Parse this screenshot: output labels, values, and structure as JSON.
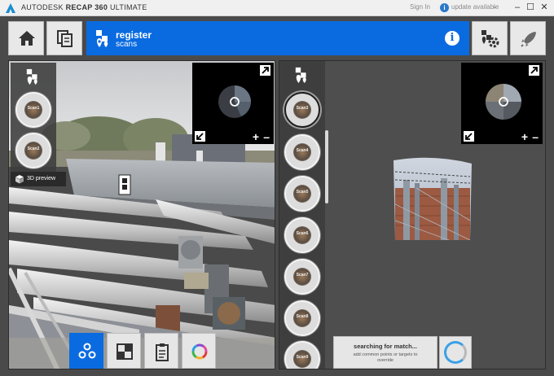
{
  "titlebar": {
    "title_brand": "AUTODESK",
    "title_product": "RECAP 360",
    "title_edition": "ULTIMATE",
    "signin": "Sign In",
    "update": "update available",
    "update_icon": "i",
    "update_caret": "⌄",
    "minimize": "–",
    "maximize": "☐",
    "close": "✕"
  },
  "banner": {
    "title": "register",
    "subtitle": "scans",
    "info_icon": "i"
  },
  "left_panel": {
    "thumbnails": [
      "Scan1",
      "Scan2"
    ],
    "preview_label": "3D preview",
    "minimap_plus": "+",
    "minimap_minus": "–"
  },
  "right_panel": {
    "thumbnails": [
      "Scan3",
      "Scan4",
      "Scan5",
      "Scan6",
      "Scan7",
      "Scan8",
      "Scan9"
    ],
    "minimap_plus": "+",
    "minimap_minus": "–",
    "search_title": "searching for match...",
    "search_subtitle": "add common points or targets to override"
  },
  "colors": {
    "accent": "#0a6be0",
    "panel_bg": "#4a4a4a",
    "spinner": "#3aa0e6"
  },
  "icons": {
    "home": "home-icon",
    "scans": "copy-icon",
    "register": "register-icon",
    "info": "info-icon",
    "settings": "settings-icon",
    "launch": "rocket-icon",
    "preview_3d": "cube-icon",
    "clusters": "clusters-icon",
    "split_view": "split-view-icon",
    "report": "clipboard-icon",
    "color_mode": "color-wheel-icon"
  }
}
